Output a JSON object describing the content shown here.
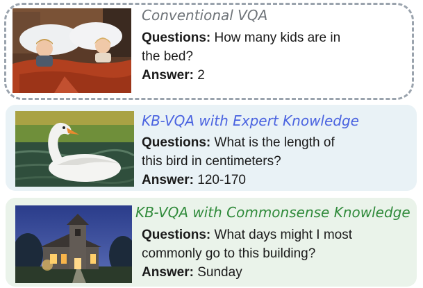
{
  "panels": [
    {
      "title": "Conventional VQA",
      "question_label": "Questions:",
      "question_line1": "How many kids are in",
      "question_line2": "the bed?",
      "answer_label": "Answer:",
      "answer": "2"
    },
    {
      "title": "KB-VQA with Expert Knowledge",
      "question_label": "Questions:",
      "question_line1": "What is the length  of",
      "question_line2": "this bird in centimeters?",
      "answer_label": "Answer:",
      "answer": "120-170"
    },
    {
      "title": "KB-VQA with Commonsense Knowledge",
      "question_label": "Questions:",
      "question_line1": "What days might I most",
      "question_line2": "commonly go to this building?",
      "answer_label": "Answer:",
      "answer": "Sunday"
    }
  ],
  "colors": {
    "conventional_title": "#6e7378",
    "expert_title": "#4a63e0",
    "commonsense_title": "#2f8a3a",
    "expert_bg": "#e9f2f6",
    "commonsense_bg": "#eaf3ea",
    "dashed_border": "#9aa3ad"
  }
}
